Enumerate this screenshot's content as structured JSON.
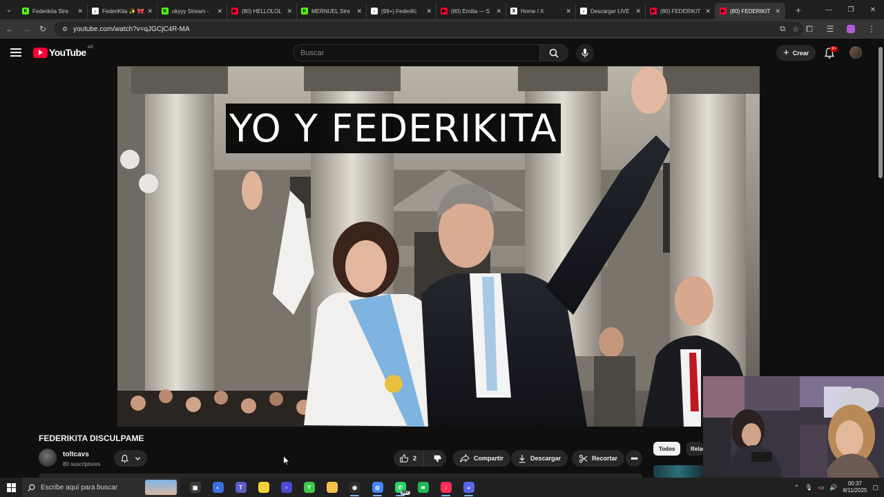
{
  "browser": {
    "tabs": [
      {
        "title": "Federikita Stre",
        "fav_color": "#53fc18",
        "fav_glyph": "K",
        "active": false
      },
      {
        "title": "FederiKita ✨ 🎀",
        "fav_color": "#ffffff",
        "fav_glyph": "♪",
        "active": false
      },
      {
        "title": "okyyy Stream -",
        "fav_color": "#53fc18",
        "fav_glyph": "K",
        "active": false
      },
      {
        "title": "(80) HELLOLOL",
        "fav_color": "#ff0033",
        "fav_glyph": "▶",
        "active": false
      },
      {
        "title": "MERNUEL Stre",
        "fav_color": "#53fc18",
        "fav_glyph": "K",
        "active": false
      },
      {
        "title": "(99+) FederiKi",
        "fav_color": "#ffffff",
        "fav_glyph": "♪",
        "active": false
      },
      {
        "title": "(80) Emilia — S",
        "fav_color": "#ff0033",
        "fav_glyph": "▶",
        "active": false
      },
      {
        "title": "Home / X",
        "fav_color": "#ffffff",
        "fav_glyph": "X",
        "active": false
      },
      {
        "title": "Descargar LIVE",
        "fav_color": "#ffffff",
        "fav_glyph": "♪",
        "active": false
      },
      {
        "title": "(80) FEDERIKIT",
        "fav_color": "#ff0033",
        "fav_glyph": "▶",
        "active": false
      },
      {
        "title": "(80) FEDERIKIT",
        "fav_color": "#ff0033",
        "fav_glyph": "▶",
        "active": true
      }
    ],
    "url": "youtube.com/watch?v=qJGCjC4R-MA"
  },
  "youtube": {
    "logo_text": "YouTube",
    "country_code": "AR",
    "search_placeholder": "Buscar",
    "create_label": "Crear",
    "notif_badge": "9+"
  },
  "video": {
    "overlay_title": "YO Y FEDERIKITA",
    "title": "FEDERIKITA DISCULPAME",
    "channel_name": "toltcavs",
    "subscribers": "80 suscriptores",
    "like_count": "2",
    "share_label": "Compartir",
    "download_label": "Descargar",
    "clip_label": "Recortar"
  },
  "sidebar_chips": {
    "active": "Todos",
    "other": "Relacionados"
  },
  "taskbar": {
    "search_placeholder": "Escribe aquí para buscar",
    "time": "00:37",
    "date": "8/11/2025",
    "apps": [
      {
        "name": "task-view-icon",
        "color": "#3a3a3a",
        "glyph": "▦"
      },
      {
        "name": "copilot-icon",
        "color": "#3b6fe0",
        "glyph": "◐"
      },
      {
        "name": "teams-icon",
        "color": "#5b5fc7",
        "glyph": "T"
      },
      {
        "name": "sticky-notes-icon",
        "color": "#f3d23a",
        "glyph": ""
      },
      {
        "name": "cortana-icon",
        "color": "#4b4bd6",
        "glyph": "○"
      },
      {
        "name": "green-app-icon",
        "color": "#3fc84a",
        "glyph": "Y"
      },
      {
        "name": "file-explorer-icon",
        "color": "#f2c14a",
        "glyph": ""
      },
      {
        "name": "obs-icon",
        "color": "#2d2d2d",
        "glyph": "◉"
      },
      {
        "name": "chrome-icon",
        "color": "#4285f4",
        "glyph": "◎"
      },
      {
        "name": "whatsapp-icon",
        "color": "#25d366",
        "glyph": "✆"
      },
      {
        "name": "spotify-icon",
        "color": "#1db954",
        "glyph": "≋"
      },
      {
        "name": "tiktok-icon",
        "color": "#fe2c55",
        "glyph": "♪"
      },
      {
        "name": "discord-icon",
        "color": "#5865f2",
        "glyph": "◕"
      }
    ],
    "whatsapp_badge": "99+"
  }
}
